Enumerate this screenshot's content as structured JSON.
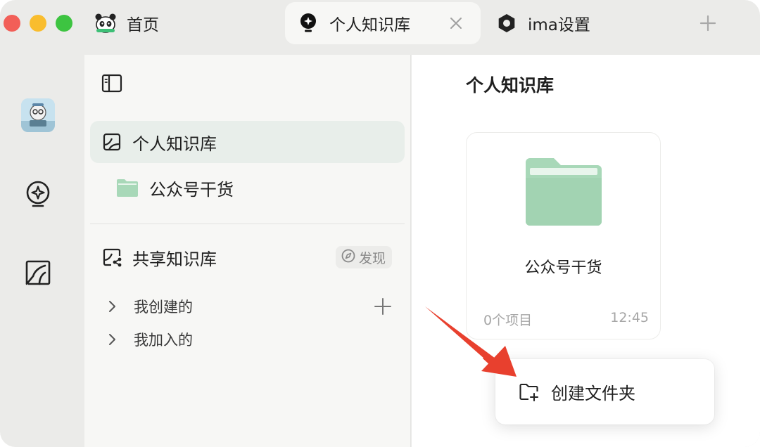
{
  "tabs": {
    "home": {
      "label": "首页",
      "icon": "panda-icon"
    },
    "knowledge": {
      "label": "个人知识库",
      "icon": "bulb-icon",
      "active": true
    },
    "settings": {
      "label": "ima设置",
      "icon": "hexagon-gear-icon"
    }
  },
  "rail": {
    "items": [
      {
        "icon": "avatar"
      },
      {
        "icon": "bulb-icon"
      },
      {
        "icon": "chart-board-icon"
      }
    ]
  },
  "sidebar": {
    "personal": {
      "label": "个人知识库",
      "icon": "personal-kb-icon"
    },
    "folder": {
      "label": "公众号干货",
      "icon": "folder-icon"
    },
    "shared": {
      "label": "共享知识库",
      "icon": "shared-kb-icon"
    },
    "discover": {
      "label": "发现",
      "icon": "compass-icon"
    },
    "created": {
      "label": "我创建的"
    },
    "joined": {
      "label": "我加入的"
    }
  },
  "main": {
    "title": "个人知识库",
    "card": {
      "name": "公众号干货",
      "count": "0个项目",
      "time": "12:45"
    }
  },
  "context_menu": {
    "create_folder": "创建文件夹"
  },
  "colors": {
    "accent_green": "#a8d8b8",
    "active_row": "#e8eeea",
    "annotation_arrow": "#e8402e"
  }
}
